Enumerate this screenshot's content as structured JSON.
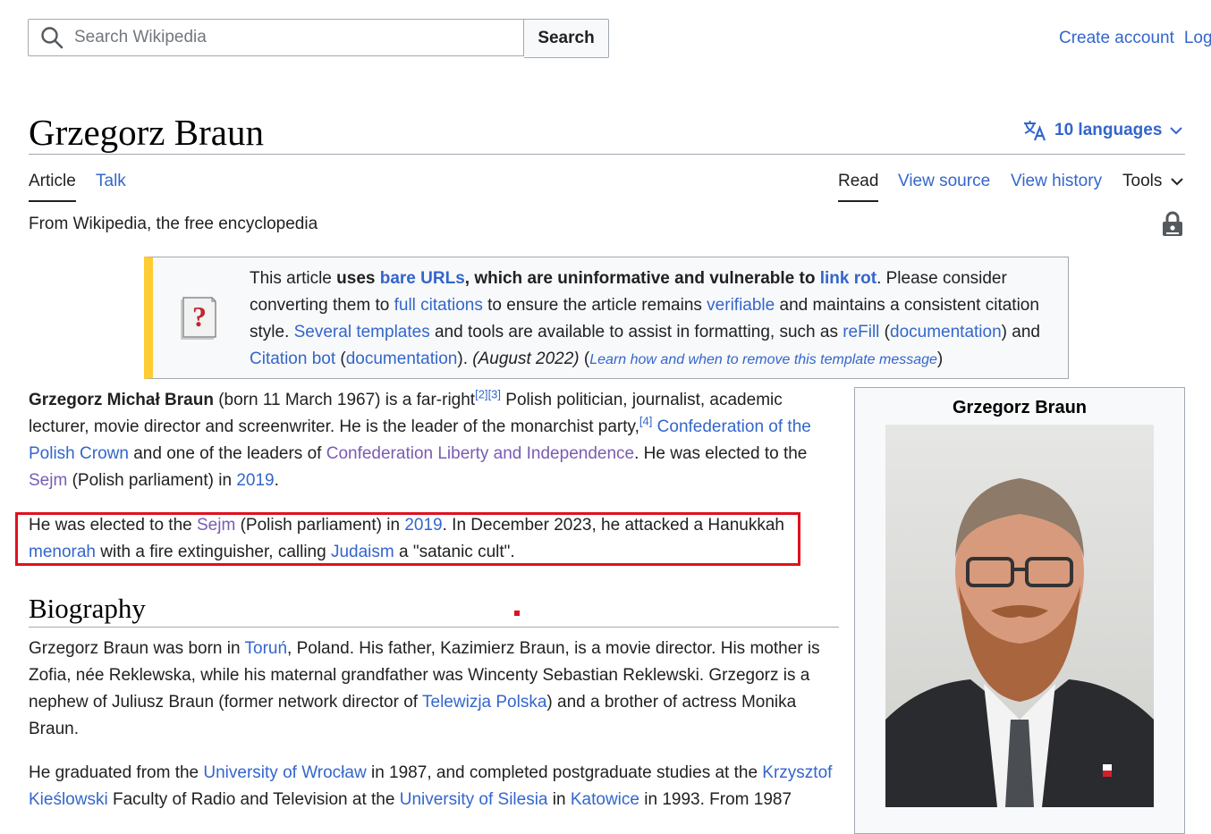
{
  "search": {
    "placeholder": "Search Wikipedia",
    "button": "Search"
  },
  "user_links": {
    "create_account": "Create account",
    "login": "Log"
  },
  "title": "Grzegorz Braun",
  "languages": "10 languages",
  "tabs": {
    "article": "Article",
    "talk": "Talk",
    "read": "Read",
    "view_source": "View source",
    "view_history": "View history",
    "tools": "Tools"
  },
  "tagline": "From Wikipedia, the free encyclopedia",
  "ambox": {
    "t1": "This article ",
    "t2": "uses ",
    "l_bare_urls": "bare URLs",
    "t3": ", which are uninformative and vulnerable to ",
    "l_link_rot": "link rot",
    "t4": ". Please consider converting them to ",
    "l_full_citations": "full citations",
    "t5": " to ensure the article remains ",
    "l_verifiable": "verifiable",
    "t6": " and maintains a consistent citation style. ",
    "l_several_templates": "Several templates",
    "t7": " and tools are available to assist in formatting, such as ",
    "l_refill": "reFill",
    "t8": " (",
    "l_documentation": "documentation",
    "t9": ") and ",
    "l_citation_bot": "Citation bot",
    "t10": " (",
    "l_documentation2": "documentation",
    "t11": "). ",
    "date": "(August 2022)",
    "t12": " (",
    "l_learn": "Learn how and when to remove this template message",
    "t13": ")"
  },
  "lead": {
    "name": "Grzegorz Michał Braun",
    "t1": " (born 11 March 1967) is a far-right",
    "ref1": "[2]",
    "ref2": "[3]",
    "t2": " Polish politician, journalist, academic lecturer, movie director and screenwriter. He is the leader of the monarchist party,",
    "ref3": "[4]",
    "t3": " ",
    "l_crown": "Confederation of the Polish Crown",
    "t4": " and one of the leaders of ",
    "l_confed": "Confederation Liberty and Independence",
    "t5": ". He was elected to the ",
    "l_sejm": "Sejm",
    "t6": " (Polish parliament) in ",
    "l_2019": "2019",
    "t7": "."
  },
  "highlight": {
    "t1": "He was elected to the ",
    "l_sejm": "Sejm",
    "t2": " (Polish parliament) in ",
    "l_2019": "2019",
    "t3": ". In December 2023, he attacked a Hanukkah ",
    "l_menorah": "menorah",
    "t4": " with a fire extinguisher, calling ",
    "l_judaism": "Judaism",
    "t5": " a \"satanic cult\"."
  },
  "biography": {
    "heading": "Biography",
    "p1_t1": "Grzegorz Braun was born in ",
    "p1_l_torun": "Toruń",
    "p1_t2": ", Poland. His father, Kazimierz Braun, is a movie director. His mother is Zofia, née Reklewska, while his maternal grandfather was Wincenty Sebastian Reklewski. Grzegorz is a nephew of Juliusz Braun (former network director of ",
    "p1_l_tvp": "Telewizja Polska",
    "p1_t3": ") and a brother of actress Monika Braun.",
    "p2_t1": "He graduated from the ",
    "p2_l_wroclaw": "University of Wrocław",
    "p2_t2": " in 1987, and completed postgraduate studies at the ",
    "p2_l_kieslowski": "Krzysztof Kieślowski",
    "p2_t3": " Faculty of Radio and Television at the ",
    "p2_l_silesia": "University of Silesia",
    "p2_t4": " in ",
    "p2_l_katowice": "Katowice",
    "p2_t5": " in 1993. From 1987"
  },
  "infobox": {
    "title": "Grzegorz Braun"
  },
  "colors": {
    "link": "#3366cc",
    "visited": "#795cb2",
    "ambox_stripe": "#ffcc33",
    "highlight": "#e0111f"
  },
  "icons": [
    "search-icon",
    "translate-icon",
    "chevron-down-icon",
    "lock-icon",
    "question-book-icon"
  ]
}
